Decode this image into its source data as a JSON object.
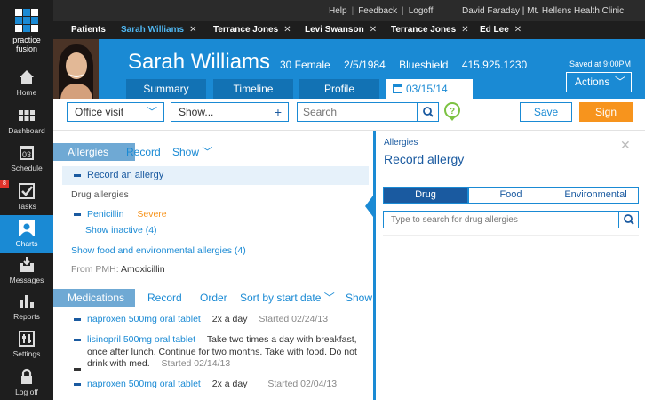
{
  "app": {
    "logo_line1": "practice",
    "logo_line2": "fusion"
  },
  "nav": [
    {
      "label": "Home",
      "icon": "home-icon"
    },
    {
      "label": "Dashboard",
      "icon": "dashboard-icon"
    },
    {
      "label": "Schedule",
      "icon": "calendar-icon",
      "day": "03"
    },
    {
      "label": "Tasks",
      "icon": "tasks-icon",
      "badge": "8"
    },
    {
      "label": "Charts",
      "icon": "charts-icon"
    },
    {
      "label": "Messages",
      "icon": "messages-icon"
    },
    {
      "label": "Reports",
      "icon": "reports-icon"
    },
    {
      "label": "Settings",
      "icon": "settings-icon"
    },
    {
      "label": "Log off",
      "icon": "lock-icon"
    }
  ],
  "topbar": {
    "help": "Help",
    "feedback": "Feedback",
    "logoff": "Logoff",
    "user": "David Faraday | Mt. Hellens Health Clinic"
  },
  "tabs": [
    {
      "label": "Patients"
    },
    {
      "label": "Sarah Williams"
    },
    {
      "label": "Terrance Jones"
    },
    {
      "label": "Levi Swanson"
    },
    {
      "label": "Terrance Jones"
    },
    {
      "label": "Ed Lee"
    }
  ],
  "patient": {
    "name": "Sarah Williams",
    "age_sex": "30 Female",
    "dob": "2/5/1984",
    "insurance": "Blueshield",
    "phone": "415.925.1230",
    "saved": "Saved at 9:00PM",
    "actions": "Actions",
    "tabs": [
      "Summary",
      "Timeline",
      "Profile"
    ],
    "date": "03/15/14"
  },
  "toolbar": {
    "visit_type": "Office visit",
    "show": "Show...",
    "search_placeholder": "Search",
    "save": "Save",
    "sign": "Sign"
  },
  "allergies": {
    "header": "Allergies",
    "record": "Record",
    "show": "Show",
    "record_an_allergy": "Record an allergy",
    "drug_heading": "Drug allergies",
    "drug_name": "Penicillin",
    "drug_severity": "Severe",
    "show_inactive": "Show inactive (4)",
    "show_food_env": "Show food and environmental allergies (4)",
    "pmh_label": "From PMH:",
    "pmh_value": "Amoxicillin"
  },
  "medications": {
    "header": "Medications",
    "record": "Record",
    "order": "Order",
    "sort": "Sort by start date",
    "show": "Show",
    "items": [
      {
        "name": "naproxen 500mg oral tablet",
        "freq": "2x a day",
        "started": "Started 02/24/13"
      },
      {
        "name": "lisinopril 500mg oral tablet",
        "line1": "Take two times a day with breakfast,",
        "line2": "once after lunch. Continue for two months. Take with food. Do not",
        "line3": "drink with med.",
        "started": "Started 02/14/13"
      },
      {
        "name": "naproxen 500mg oral tablet",
        "freq": "2x a day",
        "started": "Started 02/04/13"
      }
    ]
  },
  "panel": {
    "subtitle": "Allergies",
    "title": "Record allergy",
    "close": "✕",
    "segments": [
      "Drug",
      "Food",
      "Environmental"
    ],
    "search_placeholder": "Type to search for drug allergies"
  },
  "colors": {
    "brand": "#1a8ad4",
    "sign": "#f7941d",
    "severe": "#f7941d",
    "nav_bg": "#1e1e1e"
  }
}
